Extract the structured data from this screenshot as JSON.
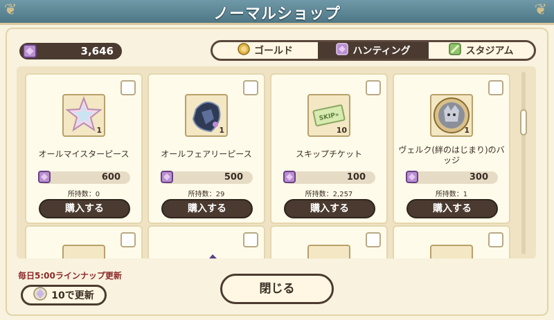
{
  "header": {
    "title": "ノーマルショップ"
  },
  "currency": {
    "amount": "3,646",
    "icon": "hunting-gem-icon"
  },
  "tabs": [
    {
      "label": "ゴールド",
      "icon": "gold-coin-icon",
      "active": false
    },
    {
      "label": "ハンティング",
      "icon": "hunting-gem-icon",
      "active": true
    },
    {
      "label": "スタジアム",
      "icon": "stadium-gem-icon",
      "active": false
    }
  ],
  "items": [
    {
      "name": "オールマイスターピース",
      "count": "1",
      "price": "600",
      "owned": "所持数：0",
      "buy_label": "購入する",
      "icon": "star-piece-icon"
    },
    {
      "name": "オールフェアリーピース",
      "count": "1",
      "price": "500",
      "owned": "所持数：29",
      "buy_label": "購入する",
      "icon": "fairy-piece-icon"
    },
    {
      "name": "スキップチケット",
      "count": "10",
      "price": "100",
      "owned": "所持数：2,257",
      "buy_label": "購入する",
      "icon": "skip-ticket-icon"
    },
    {
      "name": "ヴェルク(絆のはじまり)のバッジ",
      "count": "1",
      "price": "300",
      "owned": "所持数：1",
      "buy_label": "購入する",
      "icon": "wolf-badge-icon"
    }
  ],
  "footer": {
    "notice": "毎日5:00ラインナップ更新",
    "refresh_label": "10で更新",
    "close_label": "閉じる"
  },
  "colors": {
    "header": "#5a8595",
    "accent_dark": "#4a3a2f",
    "background": "#f8f2de",
    "notice_red": "#8c2a2a"
  }
}
